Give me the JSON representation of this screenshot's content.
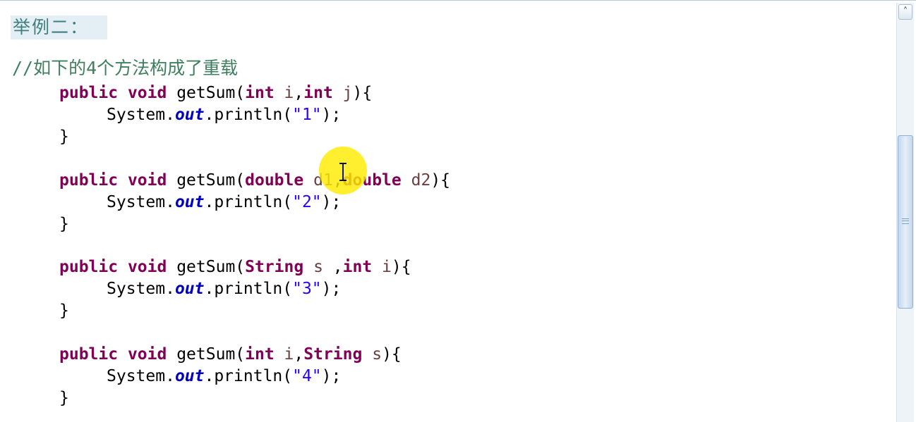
{
  "heading": "举例二：",
  "comment": "//如下的4个方法构成了重载",
  "methods": [
    {
      "kw1": "public",
      "kw2": "void",
      "name": "getSum(",
      "params": [
        {
          "type": "int",
          "name": "i",
          "sep": ","
        },
        {
          "type": "int",
          "name": "j",
          "sep": ""
        }
      ],
      "open": "){",
      "body_prefix": "System.",
      "body_field": "out",
      "body_call": ".println(",
      "body_str": "\"1\"",
      "body_end": ");",
      "close": "}"
    },
    {
      "kw1": "public",
      "kw2": "void",
      "name": "getSum(",
      "params": [
        {
          "type": "double",
          "name": "d1",
          "sep": ","
        },
        {
          "type": "double",
          "name": "d2",
          "sep": ""
        }
      ],
      "open": "){",
      "body_prefix": "System.",
      "body_field": "out",
      "body_call": ".println(",
      "body_str": "\"2\"",
      "body_end": ");",
      "close": "}"
    },
    {
      "kw1": "public",
      "kw2": "void",
      "name": "getSum(",
      "params": [
        {
          "type": "String",
          "name": "s",
          "sep": " ,"
        },
        {
          "type": "int",
          "name": "i",
          "sep": ""
        }
      ],
      "open": "){",
      "body_prefix": "System.",
      "body_field": "out",
      "body_call": ".println(",
      "body_str": "\"3\"",
      "body_end": ");",
      "close": "}"
    },
    {
      "kw1": "public",
      "kw2": "void",
      "name": "getSum(",
      "params": [
        {
          "type": "int",
          "name": "i",
          "sep": ","
        },
        {
          "type": "String",
          "name": "s",
          "sep": ""
        }
      ],
      "open": "){",
      "body_prefix": "System.",
      "body_field": "out",
      "body_call": ".println(",
      "body_str": "\"4\"",
      "body_end": ");",
      "close": "}"
    }
  ],
  "scrollbar": {
    "up_icon": "chevron-up-icon"
  },
  "colors": {
    "keyword": "#7f0055",
    "comment": "#3f7f5f",
    "heading": "#3f7f7f",
    "heading_bg": "#e3eef5",
    "string": "#2a00ff",
    "field": "#0000c0",
    "param": "#6a3e3e",
    "cursor_highlight": "#ffec00"
  }
}
